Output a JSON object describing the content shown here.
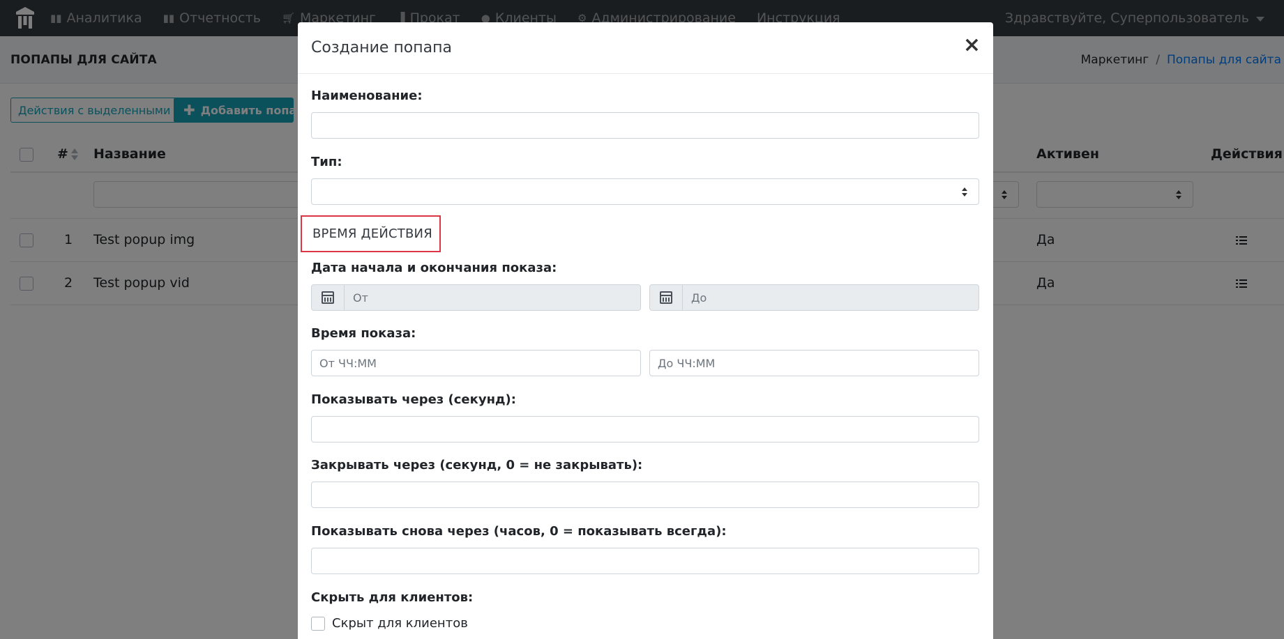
{
  "navbar": {
    "items": [
      {
        "label": "Аналитика",
        "icon": "bar-chart-icon"
      },
      {
        "label": "Отчетность",
        "icon": "bar-chart-icon"
      },
      {
        "label": "Маркетинг",
        "icon": "cart-icon"
      },
      {
        "label": "Прокат",
        "icon": "book-icon"
      },
      {
        "label": "Клиенты",
        "icon": "user-icon"
      },
      {
        "label": "Администрирование",
        "icon": "cogs-icon"
      },
      {
        "label": "Инструкция",
        "icon": ""
      }
    ],
    "greeting": "Здравствуйте, Суперпользователь"
  },
  "page": {
    "title": "ПОПАПЫ ДЛЯ САЙТА",
    "breadcrumb": {
      "parent": "Маркетинг",
      "separator": "/",
      "current": "Попапы для сайта"
    }
  },
  "toolbar": {
    "bulk_actions_label": "Действия с выделенными",
    "add_label": "Добавить попап",
    "add_icon": "plus-icon"
  },
  "table": {
    "headers": {
      "num": "#",
      "name": "Название",
      "active": "Активен",
      "actions": "Действия"
    },
    "rows": [
      {
        "num": "1",
        "name": "Test popup img",
        "active": "Да"
      },
      {
        "num": "2",
        "name": "Test popup vid",
        "active": "Да"
      }
    ]
  },
  "modal": {
    "title": "Создание попапа",
    "close_glyph": "×",
    "fields": {
      "name_label": "Наименование:",
      "type_label": "Тип:",
      "section_title": "ВРЕМЯ ДЕЙСТВИЯ",
      "date_label": "Дата начала и окончания показа:",
      "date_from_placeholder": "От",
      "date_to_placeholder": "До",
      "time_label": "Время показа:",
      "time_from_placeholder": "От ЧЧ:ММ",
      "time_to_placeholder": "До ЧЧ:ММ",
      "show_after_label": "Показывать через (секунд):",
      "close_after_label": "Закрывать через (секунд, 0 = не закрывать):",
      "show_again_label": "Показывать снова через (часов, 0 = показывать всегда):",
      "hide_label": "Скрыть для клиентов:",
      "hide_checkbox_label": "Скрыт для клиентов"
    }
  },
  "colors": {
    "navbar_bg": "#343a40",
    "accent": "#17a2b8",
    "link": "#007bff",
    "highlight_border": "#dc3545"
  }
}
